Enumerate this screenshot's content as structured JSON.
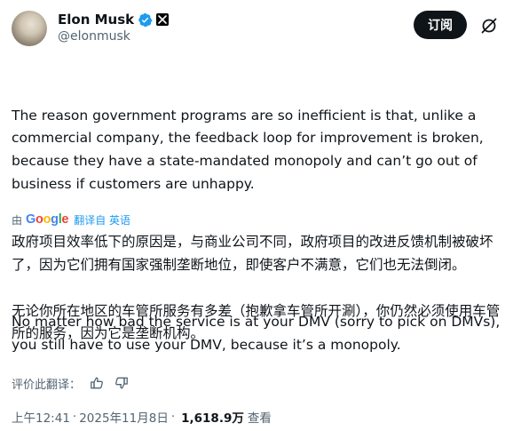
{
  "author": {
    "display_name": "Elon Musk",
    "handle": "@elonmusk",
    "verified_color": "#1d9bf0",
    "affiliation_icon": "x-logo-icon"
  },
  "header": {
    "subscribe_label": "订阅",
    "grok_icon": "grok-icon"
  },
  "tweet": {
    "paragraphs": [
      "The reason government programs are so inefficient is that, unlike a commercial company, the feedback loop for improvement is broken, because they have a state-mandated monopoly and can’t go out of business if customers are unhappy.",
      "No matter how bad the service is at your DMV (sorry to pick on DMVs), you still have to use your DMV, because it’s a monopoly."
    ]
  },
  "translation": {
    "by_label": "由",
    "google_logo": "Google",
    "translated_from": "翻译自 英语",
    "paragraphs": [
      "政府项目效率低下的原因是，与商业公司不同，政府项目的改进反馈机制被破坏了，因为它们拥有国家强制垄断地位，即使客户不满意，它们也无法倒闭。",
      "无论你所在地区的车管所服务有多差（抱歉拿车管所开涮），你仍然必须使用车管所的服务，因为它是垄断机构。"
    ],
    "rate_label": "评价此翻译："
  },
  "meta": {
    "time": "上午12:41",
    "separator": "·",
    "date": "2025年11月8日",
    "views": "1,618.9万",
    "views_label": "查看"
  }
}
